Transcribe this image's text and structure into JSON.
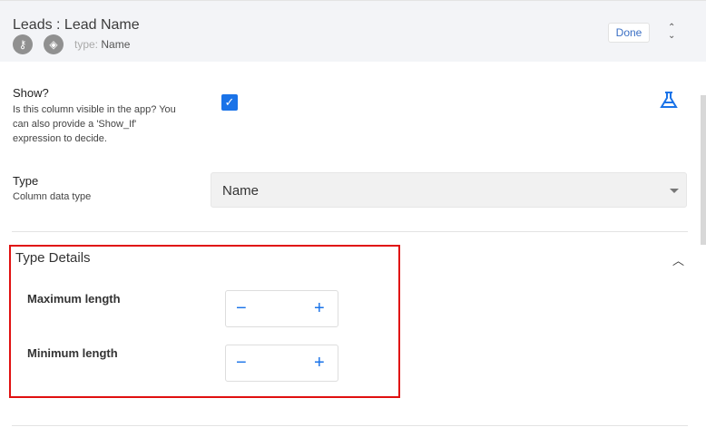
{
  "header": {
    "title": "Leads : Lead Name",
    "type_label": "type:",
    "type_value": "Name",
    "done": "Done"
  },
  "show": {
    "label": "Show?",
    "description": "Is this column visible in the app? You can also provide a 'Show_If' expression to decide.",
    "checked": true
  },
  "type": {
    "label": "Type",
    "description": "Column data type",
    "value": "Name"
  },
  "type_details": {
    "title": "Type Details",
    "max_label": "Maximum length",
    "min_label": "Minimum length",
    "minus": "−",
    "plus": "+"
  }
}
